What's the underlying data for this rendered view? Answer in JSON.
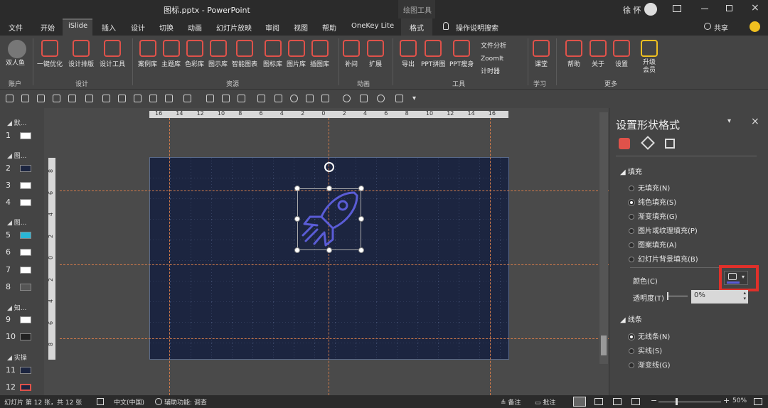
{
  "titlebar": {
    "title": "图标.pptx - PowerPoint",
    "context_tab_group": "绘图工具",
    "user": "徐 怀"
  },
  "tabs": [
    "文件",
    "开始",
    "iSlide",
    "插入",
    "设计",
    "切换",
    "动画",
    "幻灯片放映",
    "审阅",
    "视图",
    "帮助",
    "OneKey Lite",
    "格式"
  ],
  "tell_me": "操作说明搜索",
  "share": "共享",
  "ribbon": {
    "account": {
      "label": "双人鱼",
      "group": "账户"
    },
    "design": {
      "items": [
        "一键优化",
        "设计排版",
        "设计工具"
      ],
      "group": "设计"
    },
    "resources": {
      "items": [
        "案例库",
        "主题库",
        "色彩库",
        "图示库",
        "智能图表",
        "图标库",
        "图片库",
        "插图库"
      ],
      "group": "资源"
    },
    "animation": {
      "items": [
        "补间",
        "扩展"
      ],
      "group": "动画"
    },
    "tools": {
      "items": [
        "导出",
        "PPT拼图",
        "PPT瘦身"
      ],
      "side": [
        "文件分析",
        "ZoomIt",
        "计时器"
      ],
      "group": "工具"
    },
    "learn": {
      "items": [
        "课堂"
      ],
      "group": "学习"
    },
    "more": {
      "items": [
        "帮助",
        "关于",
        "设置",
        "升级会员"
      ],
      "group": "更多"
    }
  },
  "sections": [
    "默...",
    "图...",
    "图...",
    "知...",
    "实操"
  ],
  "slides": [
    "1",
    "2",
    "3",
    "4",
    "5",
    "6",
    "7",
    "8",
    "9",
    "10",
    "11",
    "12"
  ],
  "ruler_h": [
    "16",
    "14",
    "12",
    "10",
    "8",
    "6",
    "4",
    "2",
    "0",
    "2",
    "4",
    "6",
    "8",
    "10",
    "12",
    "14",
    "16"
  ],
  "ruler_v": [
    "8",
    "6",
    "4",
    "2",
    "0",
    "2",
    "4",
    "6",
    "8"
  ],
  "pane": {
    "title": "设置形状格式",
    "fill_header": "填充",
    "fill_options": [
      "无填充(N)",
      "纯色填充(S)",
      "渐变填充(G)",
      "图片或纹理填充(P)",
      "图案填充(A)",
      "幻灯片背景填充(B)"
    ],
    "color_label": "颜色(C)",
    "transparency_label": "透明度(T)",
    "transparency_value": "0%",
    "line_header": "线条",
    "line_options": [
      "无线条(N)",
      "实线(S)",
      "渐变线(G)"
    ]
  },
  "status": {
    "slide_info": "幻灯片 第 12 张，共 12 张",
    "language": "中文(中国)",
    "accessibility": "辅助功能: 调查",
    "notes": "备注",
    "comments": "批注",
    "zoom": "50%"
  },
  "colors": {
    "accent": "#e0524a",
    "rocket": "#5a5cd6",
    "slide_bg": "#1c2540"
  }
}
